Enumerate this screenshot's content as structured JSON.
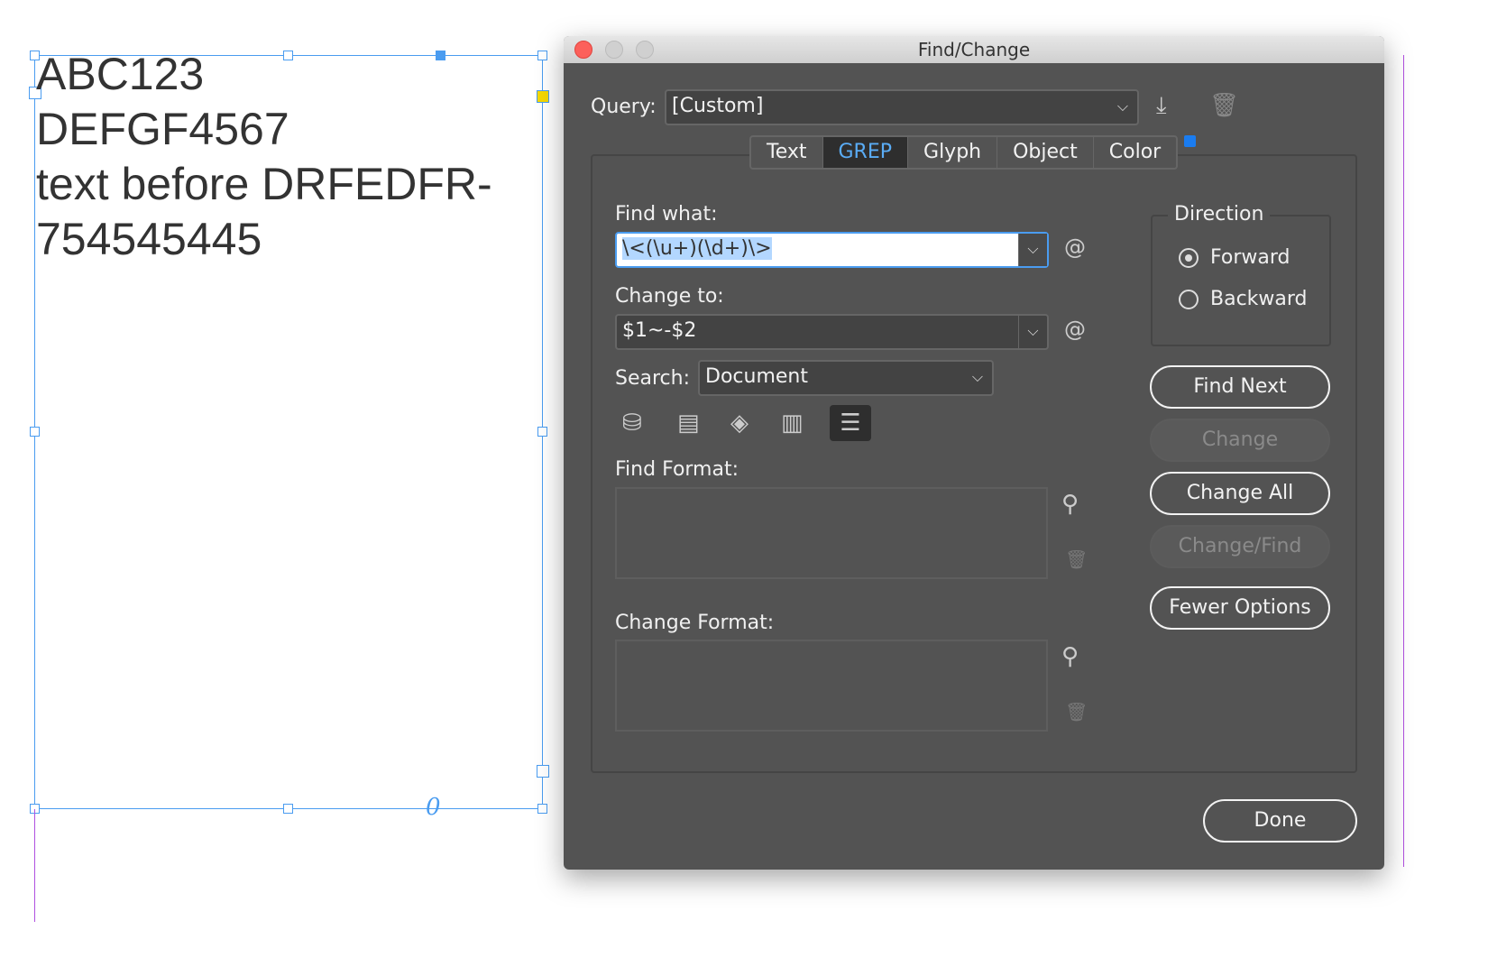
{
  "document": {
    "lines": [
      "ABC123",
      "DEFGF4567",
      "text before DRFEDFR-",
      "754545445"
    ],
    "overset_glyph": "0"
  },
  "dialog": {
    "title": "Find/Change",
    "query_label": "Query:",
    "query_value": "[Custom]",
    "tabs": [
      {
        "label": "Text"
      },
      {
        "label": "GREP",
        "active": true
      },
      {
        "label": "Glyph"
      },
      {
        "label": "Object"
      },
      {
        "label": "Color"
      }
    ],
    "find_what_label": "Find what:",
    "find_what_value": "\\<(\\u+)(\\d+)\\>",
    "change_to_label": "Change to:",
    "change_to_value": "$1~-$2",
    "search_label": "Search:",
    "search_value": "Document",
    "find_format_label": "Find Format:",
    "change_format_label": "Change Format:",
    "direction": {
      "label": "Direction",
      "options": [
        "Forward",
        "Backward"
      ],
      "selected": "Forward"
    },
    "buttons": {
      "find_next": "Find Next",
      "change": "Change",
      "change_all": "Change All",
      "change_find": "Change/Find",
      "fewer_options": "Fewer Options",
      "done": "Done"
    },
    "accent": "#5aacf5"
  }
}
